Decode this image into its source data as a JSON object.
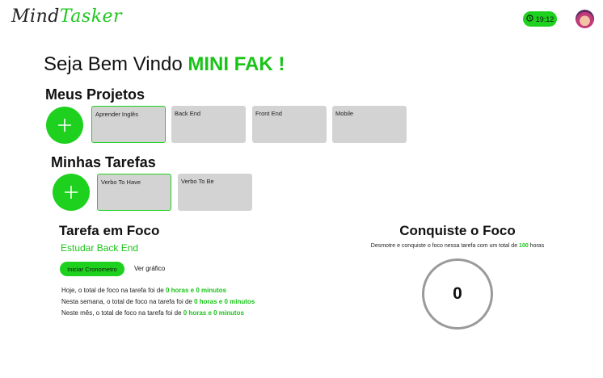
{
  "app": {
    "logo_part1": "Mind",
    "logo_part2": "Tasker"
  },
  "header": {
    "timer": "19:12"
  },
  "welcome": {
    "prefix": "Seja Bem Vindo ",
    "user": "MINI FAK !"
  },
  "projects": {
    "title": "Meus Projetos",
    "items": [
      {
        "label": "Aprender Inglês"
      },
      {
        "label": "Back End"
      },
      {
        "label": "Front End"
      },
      {
        "label": "Mobile"
      }
    ]
  },
  "tasks": {
    "title": "Minhas Tarefas",
    "items": [
      {
        "label": "Verbo To Have"
      },
      {
        "label": "Verbo To Be"
      }
    ]
  },
  "focus": {
    "title": "Tarefa em Foco",
    "task": "Estudar Back End",
    "start_button": "Iniciar Cronometro",
    "chart_link": "Ver gráfico",
    "stats": [
      {
        "text": "Hoje, o total de foco na tarefa foi de ",
        "value": "0 horas e 0 minutos"
      },
      {
        "text": "Nesta semana, o total de foco na tarefa foi de ",
        "value": "0 horas e 0 minutos"
      },
      {
        "text": "Neste mês, o total de foco na tarefa foi de ",
        "value": "0 horas e 0 minutos"
      }
    ]
  },
  "conquer": {
    "title": "Conquiste o Foco",
    "subtitle_prefix": "Desmotre e conquiste o foco nessa tarefa com um total de ",
    "hours": "100",
    "subtitle_suffix": " horas",
    "counter": "0"
  },
  "colors": {
    "accent": "#1fd11f",
    "accent_text": "#19c419",
    "card": "#d3d3d3",
    "ring": "#9a9a9a"
  }
}
